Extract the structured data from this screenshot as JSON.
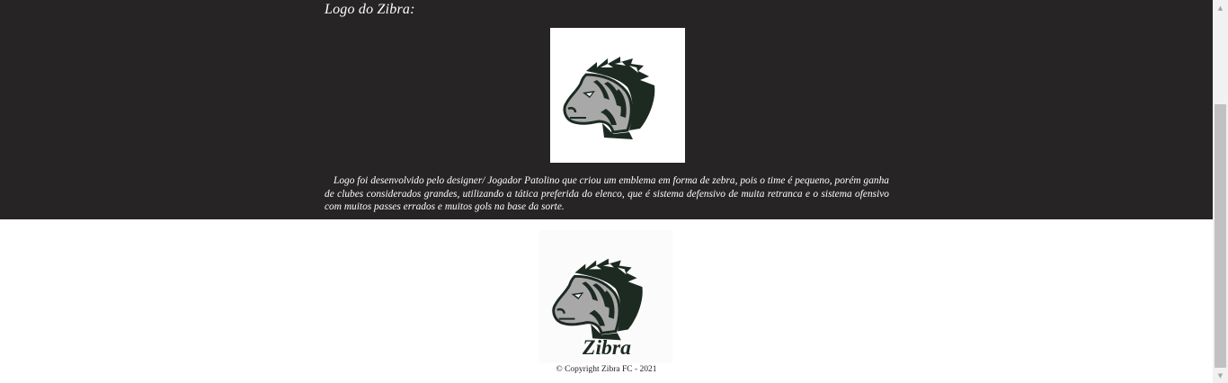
{
  "logo_section": {
    "heading": "Logo do Zibra:",
    "description": "Logo foi desenvolvido pelo designer/ Jogador Patolino que criou um emblema em forma de zebra, pois o time é pequeno, porém ganha de clubes considerados grandes, utilizando a tática preferida do elenco, que é sistema defensivo de muita retranca e o sistema ofensivo com muitos passes errados e muitos gols na base da sorte."
  },
  "footer": {
    "logo_text": "Zibra",
    "copyright": "© Copyright Zibra FC - 2021"
  },
  "colors": {
    "section_background": "#262425",
    "logo_dark_green": "#1c2a22",
    "logo_gray": "#a8a8a8"
  },
  "icons": {
    "team_logo": "zebra-head-icon",
    "scroll_up": "arrow-up-icon",
    "scroll_down": "arrow-down-icon"
  }
}
